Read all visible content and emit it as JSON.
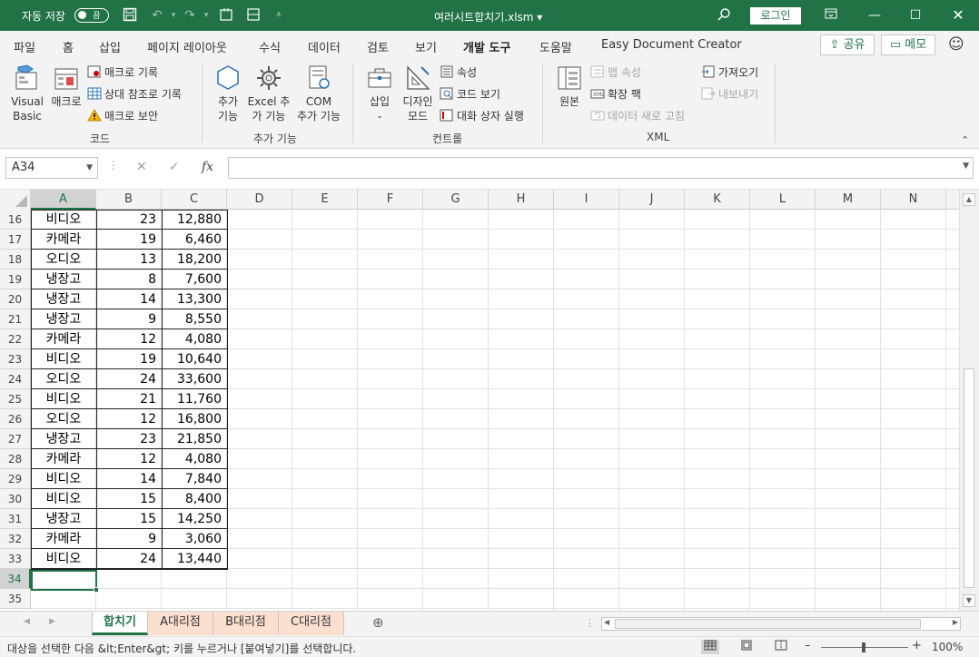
{
  "title_bar": {
    "autosave_label": "자동 저장",
    "autosave_state": "끔",
    "filename": "여러시트합치기.xlsm",
    "login_label": "로그인"
  },
  "ribbon_tabs": [
    "파일",
    "홈",
    "삽입",
    "페이지 레이아웃",
    "수식",
    "데이터",
    "검토",
    "보기",
    "개발 도구",
    "도움말",
    "Easy Document Creator"
  ],
  "active_tab": "개발 도구",
  "share_label": "공유",
  "memo_label": "메모",
  "ribbon": {
    "code": {
      "visual_basic_l1": "Visual",
      "visual_basic_l2": "Basic",
      "macro": "매크로",
      "record_macro": "매크로 기록",
      "relative_ref": "상대 참조로 기록",
      "macro_security": "매크로 보안",
      "group": "코드"
    },
    "addins": {
      "addin_l1": "추가",
      "addin_l2": "기능",
      "excel_addin_l1": "Excel 추",
      "excel_addin_l2": "가 기능",
      "com_addin_l1": "COM",
      "com_addin_l2": "추가 기능",
      "group": "추가 기능"
    },
    "controls": {
      "insert": "삽입",
      "design_mode_l1": "디자인",
      "design_mode_l2": "모드",
      "properties": "속성",
      "view_code": "코드 보기",
      "run_dialog": "대화 상자 실행",
      "group": "컨트롤"
    },
    "xml": {
      "source": "원본",
      "map_properties": "맵 속성",
      "expansion_packs": "확장 팩",
      "refresh_data": "데이터 새로 고침",
      "import": "가져오기",
      "export": "내보내기",
      "group": "XML"
    }
  },
  "name_box": "A34",
  "formula": "",
  "columns": [
    "A",
    "B",
    "C",
    "D",
    "E",
    "F",
    "G",
    "H",
    "I",
    "J",
    "K",
    "L",
    "M",
    "N"
  ],
  "rows": [
    {
      "num": "16",
      "a": "비디오",
      "b": "23",
      "c": "12,880"
    },
    {
      "num": "17",
      "a": "카메라",
      "b": "19",
      "c": "6,460"
    },
    {
      "num": "18",
      "a": "오디오",
      "b": "13",
      "c": "18,200"
    },
    {
      "num": "19",
      "a": "냉장고",
      "b": "8",
      "c": "7,600"
    },
    {
      "num": "20",
      "a": "냉장고",
      "b": "14",
      "c": "13,300"
    },
    {
      "num": "21",
      "a": "냉장고",
      "b": "9",
      "c": "8,550"
    },
    {
      "num": "22",
      "a": "카메라",
      "b": "12",
      "c": "4,080"
    },
    {
      "num": "23",
      "a": "비디오",
      "b": "19",
      "c": "10,640"
    },
    {
      "num": "24",
      "a": "오디오",
      "b": "24",
      "c": "33,600"
    },
    {
      "num": "25",
      "a": "비디오",
      "b": "21",
      "c": "11,760"
    },
    {
      "num": "26",
      "a": "오디오",
      "b": "12",
      "c": "16,800"
    },
    {
      "num": "27",
      "a": "냉장고",
      "b": "23",
      "c": "21,850"
    },
    {
      "num": "28",
      "a": "카메라",
      "b": "12",
      "c": "4,080"
    },
    {
      "num": "29",
      "a": "비디오",
      "b": "14",
      "c": "7,840"
    },
    {
      "num": "30",
      "a": "비디오",
      "b": "15",
      "c": "8,400"
    },
    {
      "num": "31",
      "a": "냉장고",
      "b": "15",
      "c": "14,250"
    },
    {
      "num": "32",
      "a": "카메라",
      "b": "9",
      "c": "3,060"
    },
    {
      "num": "33",
      "a": "비디오",
      "b": "24",
      "c": "13,440"
    },
    {
      "num": "34",
      "a": "",
      "b": "",
      "c": ""
    },
    {
      "num": "35",
      "a": "",
      "b": "",
      "c": ""
    }
  ],
  "sheets": [
    {
      "name": "합치기",
      "active": true
    },
    {
      "name": "A대리점",
      "active": false
    },
    {
      "name": "B대리점",
      "active": false
    },
    {
      "name": "C대리점",
      "active": false
    }
  ],
  "status": {
    "message": "대상을 선택한 다음 &lt;Enter&gt; 키를 누르거나 [붙여넣기]를 선택합니다.",
    "zoom": "100%"
  },
  "colors": {
    "brand": "#217346",
    "sheet_tab_orange": "#fbe0d0"
  }
}
